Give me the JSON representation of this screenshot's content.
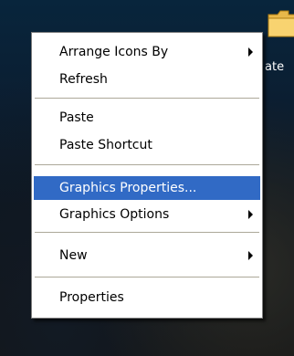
{
  "desktop": {
    "icon_name": "folder-icon",
    "icon_label": "ate"
  },
  "menu": {
    "items": [
      {
        "label": "Arrange Icons By",
        "submenu": true,
        "highlighted": false
      },
      {
        "label": "Refresh",
        "submenu": false,
        "highlighted": false
      },
      {
        "label": "Paste",
        "submenu": false,
        "highlighted": false
      },
      {
        "label": "Paste Shortcut",
        "submenu": false,
        "highlighted": false
      },
      {
        "label": "Graphics Properties...",
        "submenu": false,
        "highlighted": true
      },
      {
        "label": "Graphics Options",
        "submenu": true,
        "highlighted": false
      },
      {
        "label": "New",
        "submenu": true,
        "highlighted": false
      },
      {
        "label": "Properties",
        "submenu": false,
        "highlighted": false
      }
    ],
    "highlight_color": "#316ac5"
  }
}
